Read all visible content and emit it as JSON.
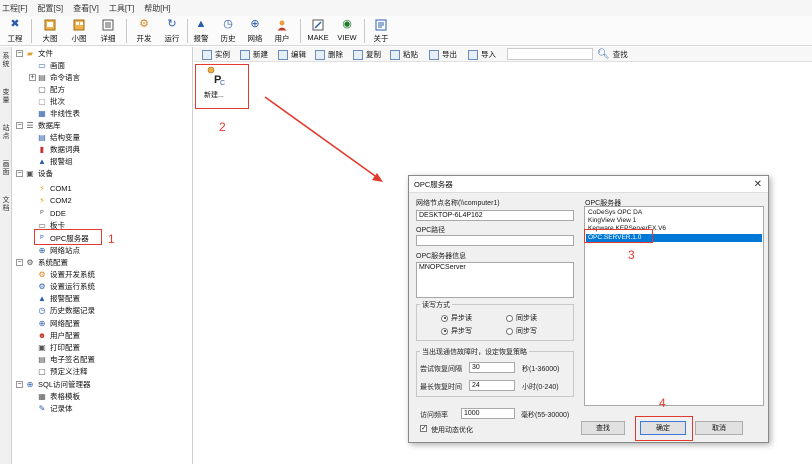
{
  "menubar": [
    "工程[F]",
    "配置[S]",
    "查看[V]",
    "工具[T]",
    "帮助[H]"
  ],
  "ribbon": [
    {
      "label": "工程",
      "icon": "tools-icon"
    },
    {
      "label": "大图",
      "icon": "large-icons-icon"
    },
    {
      "label": "小图",
      "icon": "small-icons-icon"
    },
    {
      "label": "详细",
      "icon": "details-icon"
    },
    {
      "label": "开发",
      "icon": "develop-gear-icon"
    },
    {
      "label": "运行",
      "icon": "run-icon"
    },
    {
      "label": "报警",
      "icon": "alarm-bell-icon"
    },
    {
      "label": "历史",
      "icon": "history-clock-icon"
    },
    {
      "label": "网络",
      "icon": "network-globe-icon"
    },
    {
      "label": "用户",
      "icon": "user-icon"
    },
    {
      "label": "MAKE",
      "icon": "make-icon"
    },
    {
      "label": "VIEW",
      "icon": "view-icon"
    },
    {
      "label": "关于",
      "icon": "about-icon"
    }
  ],
  "left_tabs": [
    "系统",
    "变量",
    "站点",
    "画面",
    "文档"
  ],
  "tree": [
    {
      "label": "文件",
      "level": 0
    },
    {
      "label": "画面",
      "level": 1
    },
    {
      "label": "命令语言",
      "level": 1
    },
    {
      "label": "配方",
      "level": 1
    },
    {
      "label": "批次",
      "level": 1
    },
    {
      "label": "非线性表",
      "level": 1
    },
    {
      "label": "数据库",
      "level": 0
    },
    {
      "label": "结构变量",
      "level": 1
    },
    {
      "label": "数据词典",
      "level": 1
    },
    {
      "label": "报警组",
      "level": 1
    },
    {
      "label": "设备",
      "level": 0
    },
    {
      "label": "COM1",
      "level": 1
    },
    {
      "label": "COM2",
      "level": 1
    },
    {
      "label": "DDE",
      "level": 1
    },
    {
      "label": "板卡",
      "level": 1
    },
    {
      "label": "OPC服务器",
      "level": 1
    },
    {
      "label": "网络站点",
      "level": 1
    },
    {
      "label": "系统配置",
      "level": 0
    },
    {
      "label": "设置开发系统",
      "level": 1
    },
    {
      "label": "设置运行系统",
      "level": 1
    },
    {
      "label": "报警配置",
      "level": 1
    },
    {
      "label": "历史数据记录",
      "level": 1
    },
    {
      "label": "网络配置",
      "level": 1
    },
    {
      "label": "用户配置",
      "level": 1
    },
    {
      "label": "打印配置",
      "level": 1
    },
    {
      "label": "电子签名配置",
      "level": 1
    },
    {
      "label": "预定义注释",
      "level": 1
    },
    {
      "label": "SQL访问管理器",
      "level": 0
    },
    {
      "label": "表格模板",
      "level": 1
    },
    {
      "label": "记录体",
      "level": 1
    }
  ],
  "toolbar2": [
    "实例",
    "新建",
    "编辑",
    "删除",
    "复制",
    "粘贴",
    "导出",
    "导入"
  ],
  "search_label": "查找",
  "new_item": {
    "label": "新建..."
  },
  "annotations": {
    "n1": "1",
    "n2": "2",
    "n3": "3",
    "n4": "4"
  },
  "dialog": {
    "title": "OPC服务器",
    "node_label": "网络节点名称(\\\\computer1)",
    "node_value": "DESKTOP-6L4P162",
    "path_label": "OPC路径",
    "path_value": "",
    "info_label": "OPC服务器信息",
    "info_value": "MNOPCServer",
    "rw_label": "读写方式",
    "read_async": "异步读",
    "read_sync": "同步读",
    "write_async": "异步写",
    "write_sync": "同步写",
    "reconnect_label": "当出现通信故障时，设定恢复策略",
    "retry_interval_label": "尝试恢复间隔",
    "retry_interval_value": "30",
    "retry_interval_unit": "秒(1-36000)",
    "max_retry_label": "最长恢复时间",
    "max_retry_value": "24",
    "max_retry_unit": "小时(0-240)",
    "freq_label": "访问频率",
    "freq_value": "1000",
    "freq_unit": "毫秒(55-30000)",
    "dynamic_opt": "使用动态优化",
    "servers_label": "OPC服务器",
    "servers": [
      "CoDeSys OPC DA",
      "KingView View 1",
      "Kepware.KEPServerEX.V6",
      "OPC.SERVER.1.0"
    ],
    "selected_server": "OPC.SERVER.1.0",
    "btn_find": "查找",
    "btn_ok": "确定",
    "btn_cancel": "取消"
  }
}
